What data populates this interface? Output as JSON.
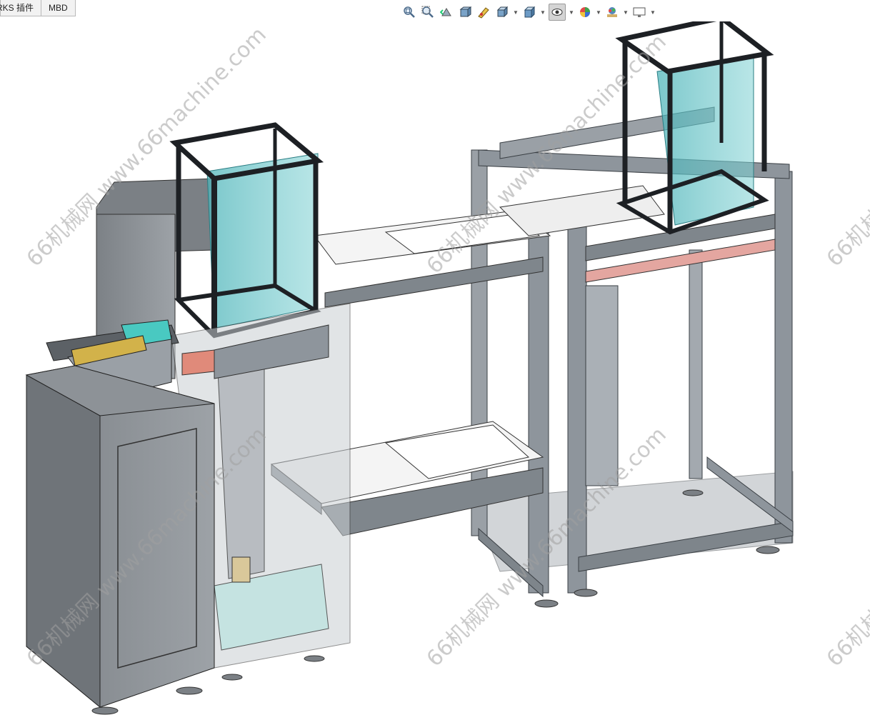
{
  "tabs": [
    {
      "label": "RKS 插件"
    },
    {
      "label": "MBD"
    }
  ],
  "heads_up_toolbar": {
    "buttons": [
      {
        "name": "zoom-to-fit",
        "icon": "zoom-fit-icon"
      },
      {
        "name": "zoom-to-area",
        "icon": "zoom-area-icon"
      },
      {
        "name": "previous-view",
        "icon": "previous-view-icon"
      },
      {
        "name": "section-view",
        "icon": "section-view-icon"
      },
      {
        "name": "dynamic-annotation",
        "icon": "annotation-icon"
      },
      {
        "name": "view-orientation",
        "icon": "view-orientation-icon"
      },
      {
        "name": "display-style",
        "icon": "display-style-icon"
      },
      {
        "name": "hide-show-items",
        "icon": "hide-show-eye-icon"
      },
      {
        "name": "edit-appearance",
        "icon": "appearance-sphere-icon"
      },
      {
        "name": "apply-scene",
        "icon": "scene-icon"
      },
      {
        "name": "view-settings",
        "icon": "monitor-icon"
      }
    ]
  },
  "watermark": {
    "text": "66机械网 www.66machine.com",
    "color": "#a0a0a0"
  },
  "colors": {
    "frame": "#8e959c",
    "frame_dark": "#3a3f44",
    "glass": "#5fbfc4",
    "cabinet": "#8a8f94",
    "pink_plate": "#e8a3a3",
    "cyan_part": "#49c9c1"
  }
}
